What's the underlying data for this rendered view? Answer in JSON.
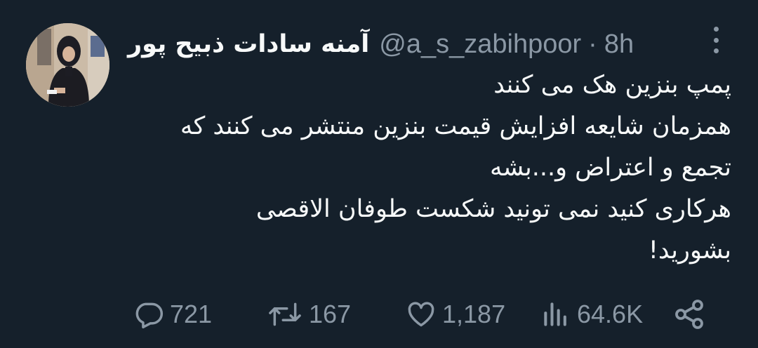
{
  "tweet": {
    "display_name": "آمنه سادات ذبیح پور",
    "handle": "@a_s_zabihpoor",
    "separator": "·",
    "time": "8h",
    "content_lines": [
      "پمپ بنزین هک می کنند",
      "همزمان شایعه افزایش قیمت بنزین منتشر می کنند که",
      "تجمع و اعتراض و...بشه",
      "هرکاری کنید نمی تونید شکست طوفان الاقصی",
      "بشورید!"
    ]
  },
  "actions": {
    "reply_count": "721",
    "retweet_count": "167",
    "like_count": "1,187",
    "view_count": "64.6K"
  },
  "icons": {
    "reply": "comment-icon",
    "retweet": "retweet-icon",
    "like": "heart-icon",
    "views": "views-icon",
    "share": "share-icon",
    "more": "more-icon"
  },
  "colors": {
    "background": "#15202b",
    "text_primary": "#f7f9f9",
    "text_secondary": "#8b98a5"
  }
}
